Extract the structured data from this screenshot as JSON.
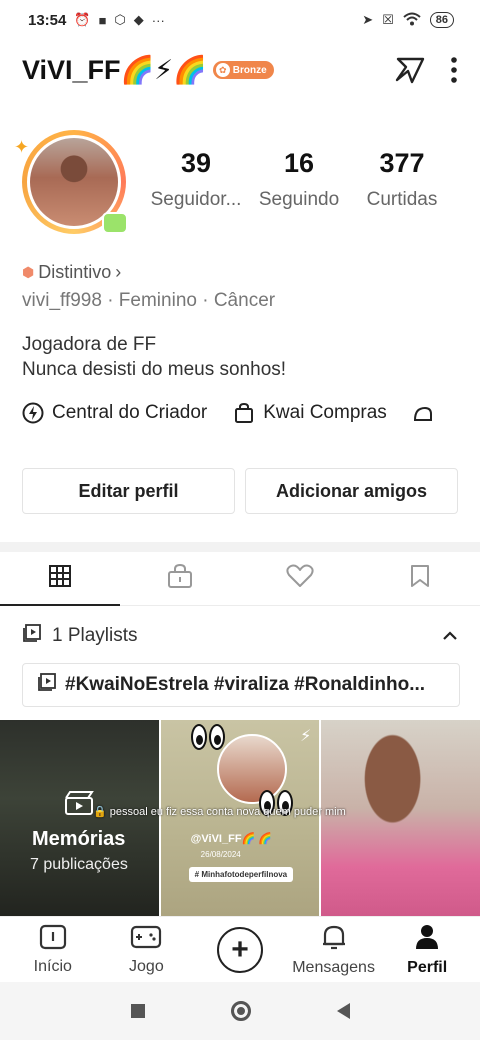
{
  "status_bar": {
    "time": "13:54",
    "battery": "86",
    "left_icons": [
      "alarm-icon",
      "video-icon",
      "app-icon",
      "shield-icon"
    ],
    "right_icons": [
      "location-icon",
      "sim-icon",
      "wifi-icon"
    ]
  },
  "header": {
    "username": "ViVI_FF🌈⚡🌈",
    "badge": "Bronze"
  },
  "stats": [
    {
      "value": "39",
      "label": "Seguidor..."
    },
    {
      "value": "16",
      "label": "Seguindo"
    },
    {
      "value": "377",
      "label": "Curtidas"
    }
  ],
  "profile": {
    "distintivo": "Distintivo",
    "meta": "vivi_ff998 · Feminino · Câncer",
    "bio_line1": "Jogadora de FF",
    "bio_line2": "Nunca desisti do meus sonhos!"
  },
  "shortcuts": {
    "creator": "Central do Criador",
    "shop": "Kwai Compras"
  },
  "buttons": {
    "edit": "Editar perfil",
    "add_friends": "Adicionar amigos"
  },
  "tabs": [
    "grid-icon",
    "lock-icon",
    "heart-icon",
    "bookmark-icon"
  ],
  "playlists": {
    "label": "1 Playlists",
    "hashtags": "#KwaiNoEstrela #viraliza #Ronaldinho..."
  },
  "grid": {
    "memories_title": "Memórias",
    "memories_count": "7 publicações",
    "cell2_name": "@ViVI_FF🌈 🌈",
    "cell2_date": "26/08/2024",
    "cell2_tag": "# Minhafotodeperfilnova",
    "overlay_caption": "pessoal eu fiz essa conta nova quem puder mim"
  },
  "bottom_nav": [
    {
      "label": "Início",
      "icon": "home-icon"
    },
    {
      "label": "Jogo",
      "icon": "gamepad-icon"
    },
    {
      "label": "",
      "icon": "plus-icon"
    },
    {
      "label": "Mensagens",
      "icon": "bell-icon"
    },
    {
      "label": "Perfil",
      "icon": "person-icon"
    }
  ],
  "colors": {
    "badge_bronze": "#f0864a",
    "accent_text": "#222222",
    "muted_text": "#777777"
  }
}
